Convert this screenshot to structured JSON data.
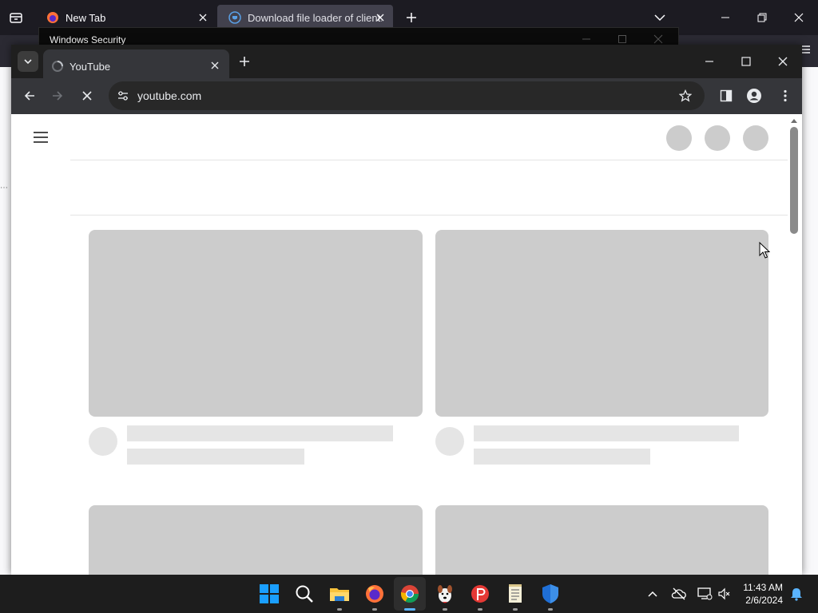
{
  "firefox": {
    "tabs": [
      {
        "title": "New Tab"
      },
      {
        "title": "Download file loader of client.e"
      }
    ]
  },
  "dialog": {
    "title": "Windows Security"
  },
  "chrome": {
    "tab_title": "YouTube",
    "url": "youtube.com"
  },
  "taskbar": {
    "time": "11:43 AM",
    "date": "2/6/2024",
    "apps": [
      "start-icon",
      "search-icon",
      "file-explorer-icon",
      "firefox-icon",
      "chrome-icon",
      "dog-app-icon",
      "psiphon-icon",
      "notepad-icon",
      "windows-defender-icon"
    ]
  },
  "colors": {
    "skeleton": "#cccccc",
    "chrome_dark": "#35363a",
    "taskbar": "#1d1d1d"
  }
}
